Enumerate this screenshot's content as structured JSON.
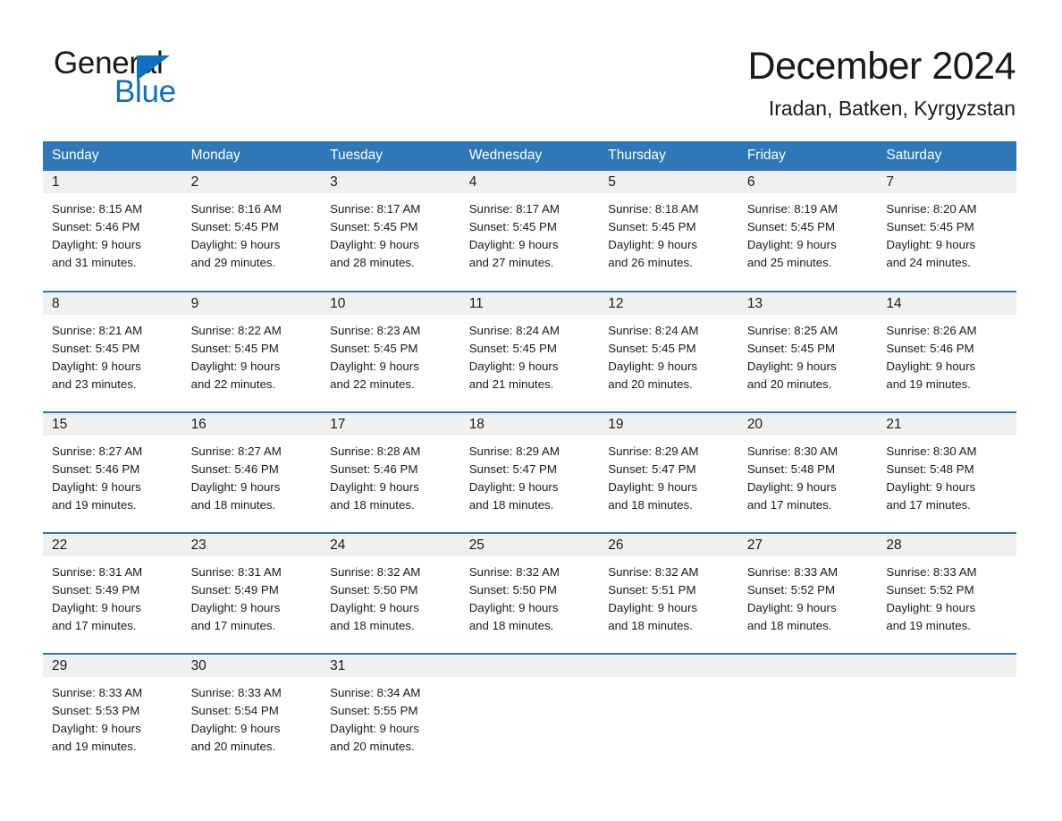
{
  "brand": {
    "name_first": "General",
    "name_second": "Blue",
    "accent_color": "#0f6fc0",
    "triangle_icon": "triangle-icon"
  },
  "header": {
    "title": "December 2024",
    "location": "Iradan, Batken, Kyrgyzstan"
  },
  "theme": {
    "header_blue": "#2e77b8",
    "row_band_gray": "#f0f0f0",
    "text_color": "#1a1a1a"
  },
  "calendar": {
    "weekday_headers": [
      "Sunday",
      "Monday",
      "Tuesday",
      "Wednesday",
      "Thursday",
      "Friday",
      "Saturday"
    ],
    "weeks": [
      [
        {
          "day": "1",
          "sunrise": "Sunrise: 8:15 AM",
          "sunset": "Sunset: 5:46 PM",
          "daylight_line1": "Daylight: 9 hours",
          "daylight_line2": "and 31 minutes."
        },
        {
          "day": "2",
          "sunrise": "Sunrise: 8:16 AM",
          "sunset": "Sunset: 5:45 PM",
          "daylight_line1": "Daylight: 9 hours",
          "daylight_line2": "and 29 minutes."
        },
        {
          "day": "3",
          "sunrise": "Sunrise: 8:17 AM",
          "sunset": "Sunset: 5:45 PM",
          "daylight_line1": "Daylight: 9 hours",
          "daylight_line2": "and 28 minutes."
        },
        {
          "day": "4",
          "sunrise": "Sunrise: 8:17 AM",
          "sunset": "Sunset: 5:45 PM",
          "daylight_line1": "Daylight: 9 hours",
          "daylight_line2": "and 27 minutes."
        },
        {
          "day": "5",
          "sunrise": "Sunrise: 8:18 AM",
          "sunset": "Sunset: 5:45 PM",
          "daylight_line1": "Daylight: 9 hours",
          "daylight_line2": "and 26 minutes."
        },
        {
          "day": "6",
          "sunrise": "Sunrise: 8:19 AM",
          "sunset": "Sunset: 5:45 PM",
          "daylight_line1": "Daylight: 9 hours",
          "daylight_line2": "and 25 minutes."
        },
        {
          "day": "7",
          "sunrise": "Sunrise: 8:20 AM",
          "sunset": "Sunset: 5:45 PM",
          "daylight_line1": "Daylight: 9 hours",
          "daylight_line2": "and 24 minutes."
        }
      ],
      [
        {
          "day": "8",
          "sunrise": "Sunrise: 8:21 AM",
          "sunset": "Sunset: 5:45 PM",
          "daylight_line1": "Daylight: 9 hours",
          "daylight_line2": "and 23 minutes."
        },
        {
          "day": "9",
          "sunrise": "Sunrise: 8:22 AM",
          "sunset": "Sunset: 5:45 PM",
          "daylight_line1": "Daylight: 9 hours",
          "daylight_line2": "and 22 minutes."
        },
        {
          "day": "10",
          "sunrise": "Sunrise: 8:23 AM",
          "sunset": "Sunset: 5:45 PM",
          "daylight_line1": "Daylight: 9 hours",
          "daylight_line2": "and 22 minutes."
        },
        {
          "day": "11",
          "sunrise": "Sunrise: 8:24 AM",
          "sunset": "Sunset: 5:45 PM",
          "daylight_line1": "Daylight: 9 hours",
          "daylight_line2": "and 21 minutes."
        },
        {
          "day": "12",
          "sunrise": "Sunrise: 8:24 AM",
          "sunset": "Sunset: 5:45 PM",
          "daylight_line1": "Daylight: 9 hours",
          "daylight_line2": "and 20 minutes."
        },
        {
          "day": "13",
          "sunrise": "Sunrise: 8:25 AM",
          "sunset": "Sunset: 5:45 PM",
          "daylight_line1": "Daylight: 9 hours",
          "daylight_line2": "and 20 minutes."
        },
        {
          "day": "14",
          "sunrise": "Sunrise: 8:26 AM",
          "sunset": "Sunset: 5:46 PM",
          "daylight_line1": "Daylight: 9 hours",
          "daylight_line2": "and 19 minutes."
        }
      ],
      [
        {
          "day": "15",
          "sunrise": "Sunrise: 8:27 AM",
          "sunset": "Sunset: 5:46 PM",
          "daylight_line1": "Daylight: 9 hours",
          "daylight_line2": "and 19 minutes."
        },
        {
          "day": "16",
          "sunrise": "Sunrise: 8:27 AM",
          "sunset": "Sunset: 5:46 PM",
          "daylight_line1": "Daylight: 9 hours",
          "daylight_line2": "and 18 minutes."
        },
        {
          "day": "17",
          "sunrise": "Sunrise: 8:28 AM",
          "sunset": "Sunset: 5:46 PM",
          "daylight_line1": "Daylight: 9 hours",
          "daylight_line2": "and 18 minutes."
        },
        {
          "day": "18",
          "sunrise": "Sunrise: 8:29 AM",
          "sunset": "Sunset: 5:47 PM",
          "daylight_line1": "Daylight: 9 hours",
          "daylight_line2": "and 18 minutes."
        },
        {
          "day": "19",
          "sunrise": "Sunrise: 8:29 AM",
          "sunset": "Sunset: 5:47 PM",
          "daylight_line1": "Daylight: 9 hours",
          "daylight_line2": "and 18 minutes."
        },
        {
          "day": "20",
          "sunrise": "Sunrise: 8:30 AM",
          "sunset": "Sunset: 5:48 PM",
          "daylight_line1": "Daylight: 9 hours",
          "daylight_line2": "and 17 minutes."
        },
        {
          "day": "21",
          "sunrise": "Sunrise: 8:30 AM",
          "sunset": "Sunset: 5:48 PM",
          "daylight_line1": "Daylight: 9 hours",
          "daylight_line2": "and 17 minutes."
        }
      ],
      [
        {
          "day": "22",
          "sunrise": "Sunrise: 8:31 AM",
          "sunset": "Sunset: 5:49 PM",
          "daylight_line1": "Daylight: 9 hours",
          "daylight_line2": "and 17 minutes."
        },
        {
          "day": "23",
          "sunrise": "Sunrise: 8:31 AM",
          "sunset": "Sunset: 5:49 PM",
          "daylight_line1": "Daylight: 9 hours",
          "daylight_line2": "and 17 minutes."
        },
        {
          "day": "24",
          "sunrise": "Sunrise: 8:32 AM",
          "sunset": "Sunset: 5:50 PM",
          "daylight_line1": "Daylight: 9 hours",
          "daylight_line2": "and 18 minutes."
        },
        {
          "day": "25",
          "sunrise": "Sunrise: 8:32 AM",
          "sunset": "Sunset: 5:50 PM",
          "daylight_line1": "Daylight: 9 hours",
          "daylight_line2": "and 18 minutes."
        },
        {
          "day": "26",
          "sunrise": "Sunrise: 8:32 AM",
          "sunset": "Sunset: 5:51 PM",
          "daylight_line1": "Daylight: 9 hours",
          "daylight_line2": "and 18 minutes."
        },
        {
          "day": "27",
          "sunrise": "Sunrise: 8:33 AM",
          "sunset": "Sunset: 5:52 PM",
          "daylight_line1": "Daylight: 9 hours",
          "daylight_line2": "and 18 minutes."
        },
        {
          "day": "28",
          "sunrise": "Sunrise: 8:33 AM",
          "sunset": "Sunset: 5:52 PM",
          "daylight_line1": "Daylight: 9 hours",
          "daylight_line2": "and 19 minutes."
        }
      ],
      [
        {
          "day": "29",
          "sunrise": "Sunrise: 8:33 AM",
          "sunset": "Sunset: 5:53 PM",
          "daylight_line1": "Daylight: 9 hours",
          "daylight_line2": "and 19 minutes."
        },
        {
          "day": "30",
          "sunrise": "Sunrise: 8:33 AM",
          "sunset": "Sunset: 5:54 PM",
          "daylight_line1": "Daylight: 9 hours",
          "daylight_line2": "and 20 minutes."
        },
        {
          "day": "31",
          "sunrise": "Sunrise: 8:34 AM",
          "sunset": "Sunset: 5:55 PM",
          "daylight_line1": "Daylight: 9 hours",
          "daylight_line2": "and 20 minutes."
        },
        {
          "day": "",
          "sunrise": "",
          "sunset": "",
          "daylight_line1": "",
          "daylight_line2": ""
        },
        {
          "day": "",
          "sunrise": "",
          "sunset": "",
          "daylight_line1": "",
          "daylight_line2": ""
        },
        {
          "day": "",
          "sunrise": "",
          "sunset": "",
          "daylight_line1": "",
          "daylight_line2": ""
        },
        {
          "day": "",
          "sunrise": "",
          "sunset": "",
          "daylight_line1": "",
          "daylight_line2": ""
        }
      ]
    ]
  }
}
